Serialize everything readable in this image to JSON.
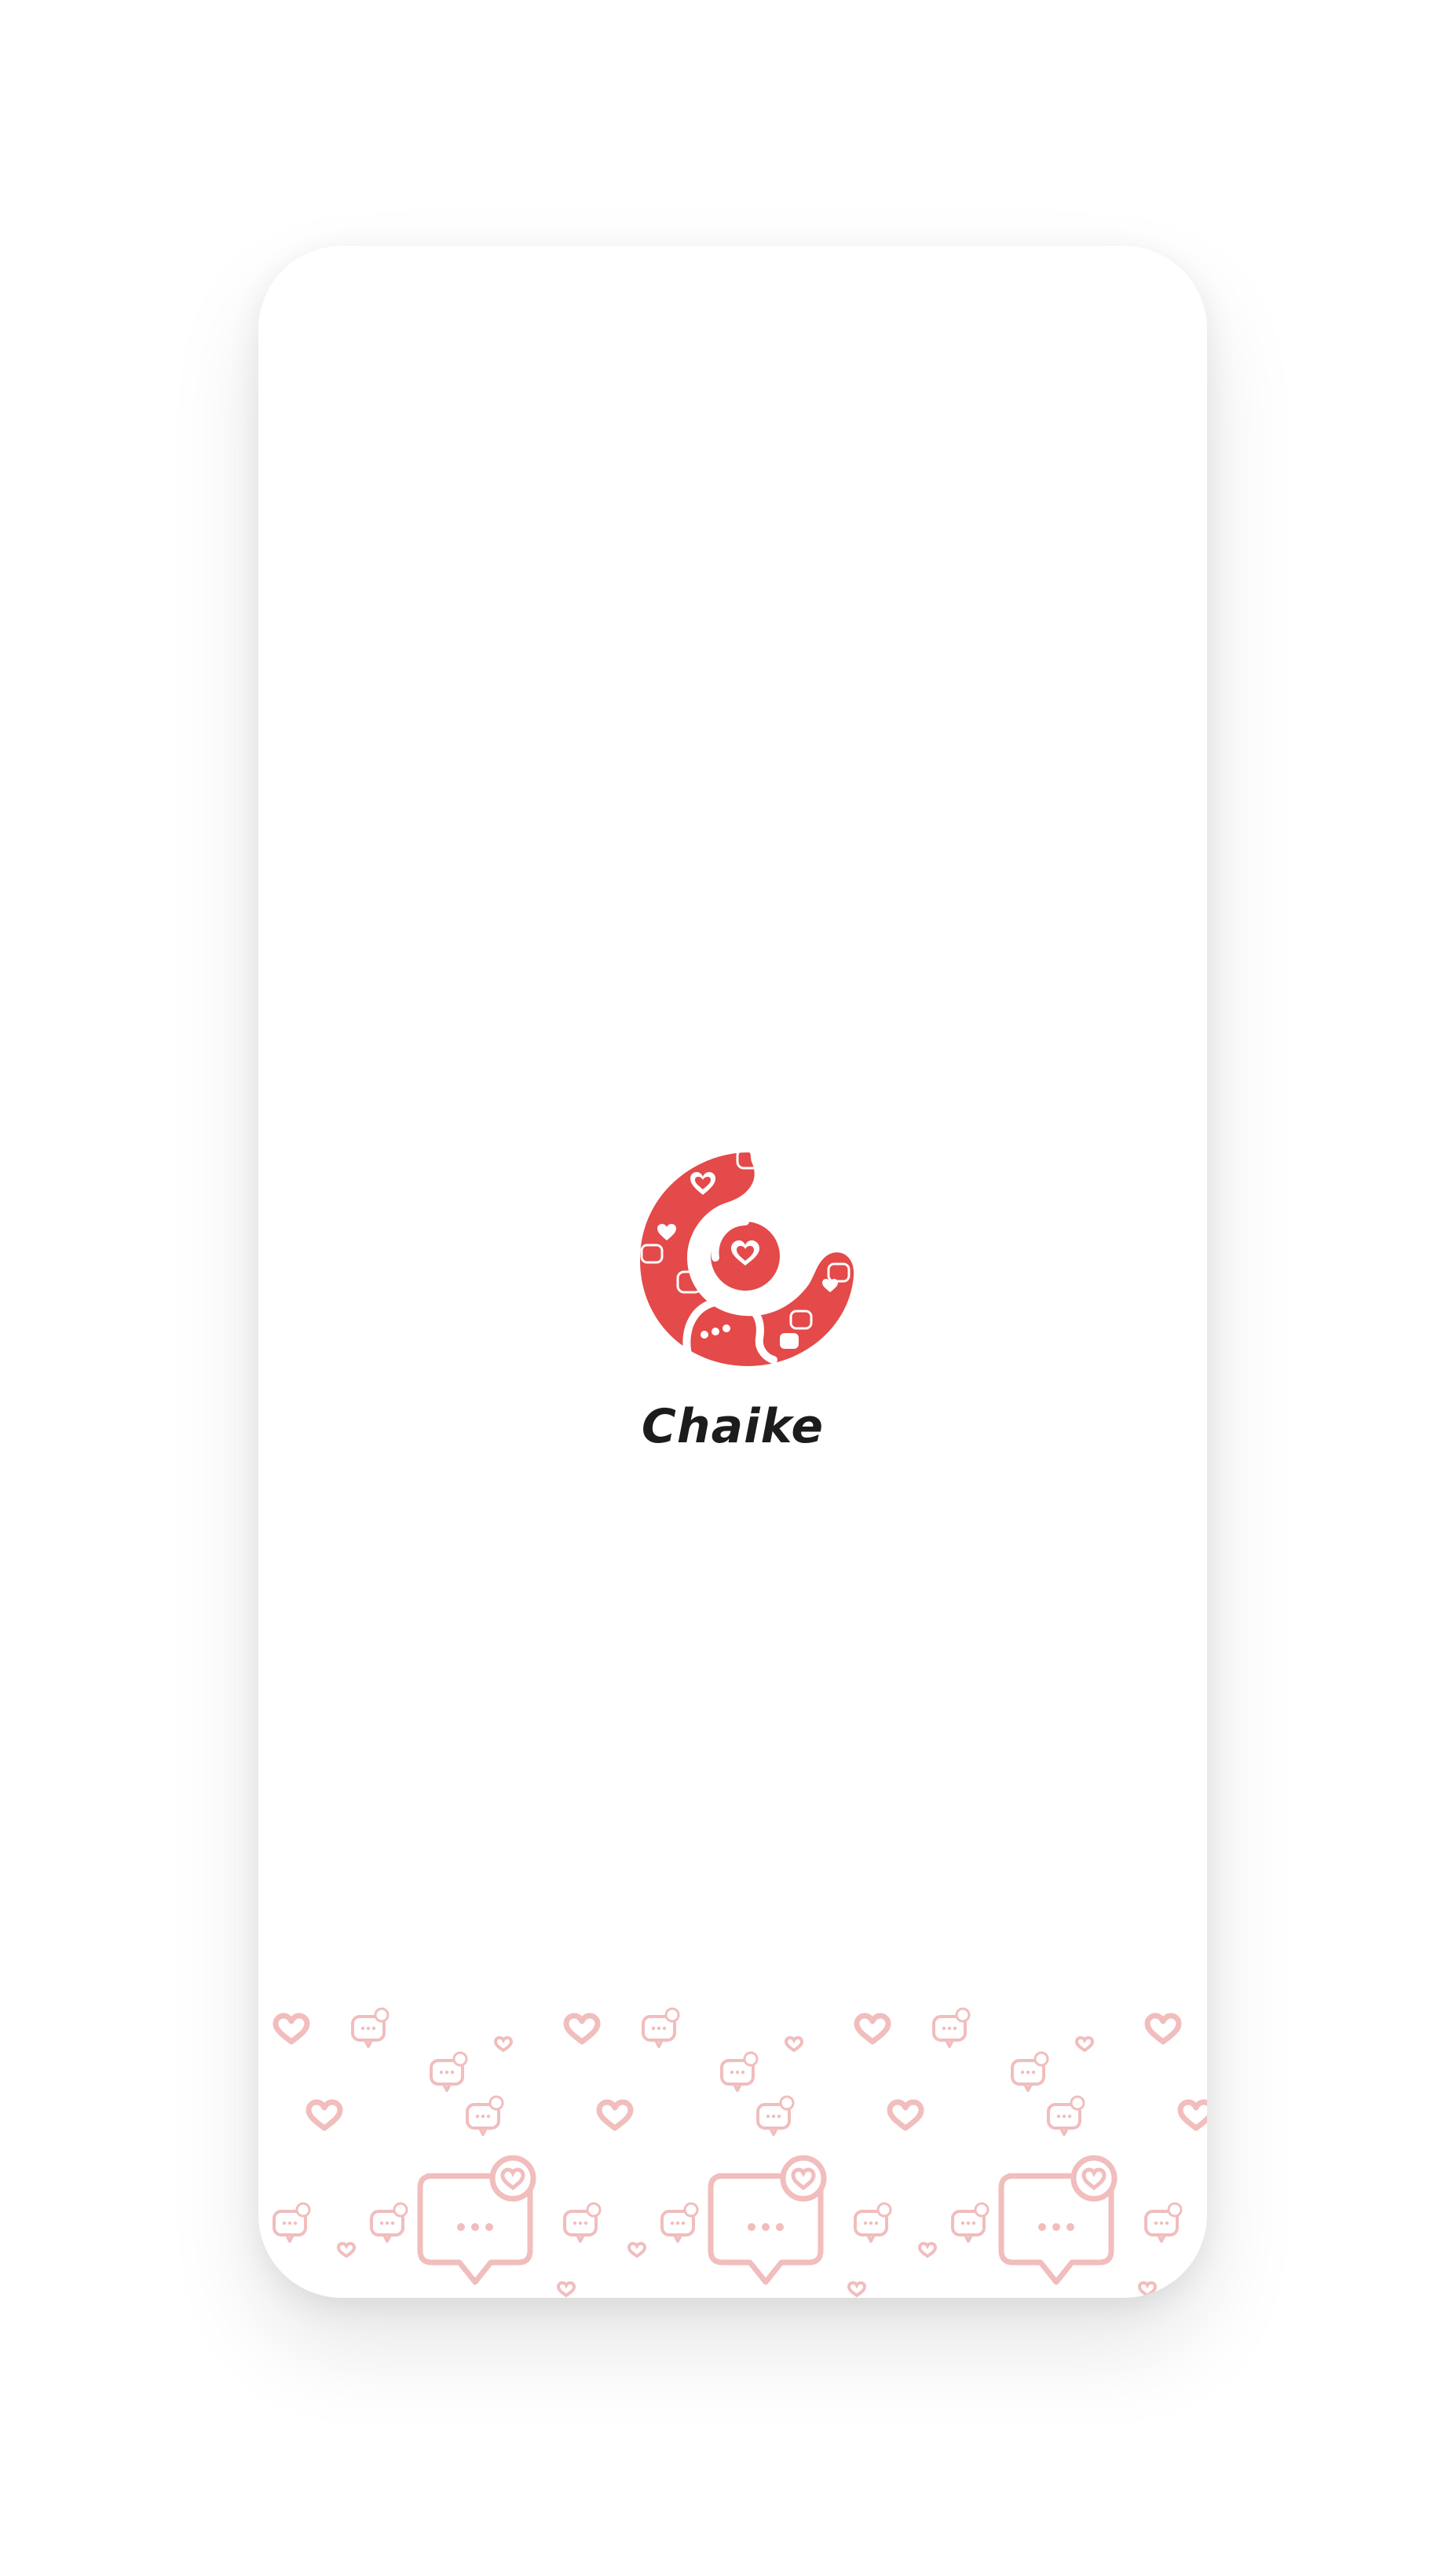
{
  "app": {
    "name": "Chaike"
  },
  "colors": {
    "brand_red": "#E34A49",
    "pattern_pink": "#F1BDBD",
    "text_dark": "#1C1C1C",
    "background": "#FFFFFF"
  },
  "icons": {
    "logo": "chaike-logo",
    "pattern_heart": "heart-icon",
    "pattern_bubble": "chat-bubble-heart-icon"
  }
}
